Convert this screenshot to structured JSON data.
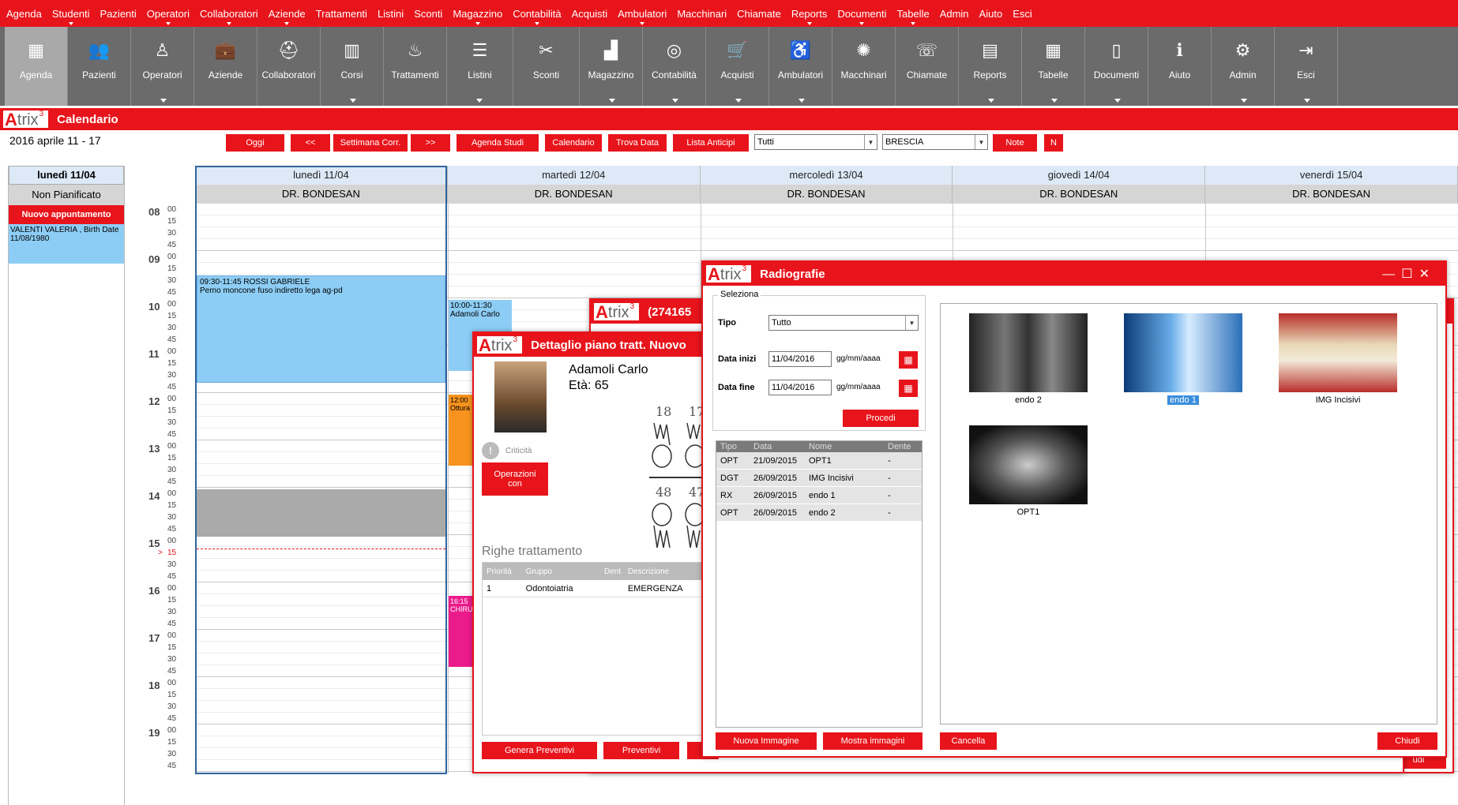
{
  "menu": [
    "Agenda",
    "Studenti",
    "Pazienti",
    "Operatori",
    "Collaboratori",
    "Aziende",
    "Trattamenti",
    "Listini",
    "Sconti",
    "Magazzino",
    "Contabilità",
    "Acquisti",
    "Ambulatori",
    "Macchinari",
    "Chiamate",
    "Reports",
    "Documenti",
    "Tabelle",
    "Admin",
    "Aiuto",
    "Esci"
  ],
  "toolbar": [
    {
      "label": "Agenda",
      "icon": "calendar-icon"
    },
    {
      "label": "Pazienti",
      "icon": "users-icon"
    },
    {
      "label": "Operatori",
      "icon": "operator-icon"
    },
    {
      "label": "Aziende",
      "icon": "briefcase-icon"
    },
    {
      "label": "Collaboratori",
      "icon": "collaborator-icon"
    },
    {
      "label": "Corsi",
      "icon": "books-icon"
    },
    {
      "label": "Trattamenti",
      "icon": "treatment-icon"
    },
    {
      "label": "Listini",
      "icon": "price-list-icon"
    },
    {
      "label": "Sconti",
      "icon": "discount-tag-icon"
    },
    {
      "label": "Magazzino",
      "icon": "warehouse-chart-icon"
    },
    {
      "label": "Contabilità",
      "icon": "coins-icon"
    },
    {
      "label": "Acquisti",
      "icon": "cart-icon"
    },
    {
      "label": "Ambulatori",
      "icon": "dental-chair-icon"
    },
    {
      "label": "Macchinari",
      "icon": "gear-machine-icon"
    },
    {
      "label": "Chiamate",
      "icon": "phone-icon"
    },
    {
      "label": "Reports",
      "icon": "report-icon"
    },
    {
      "label": "Tabelle",
      "icon": "table-icon"
    },
    {
      "label": "Documenti",
      "icon": "document-icon"
    },
    {
      "label": "Aiuto",
      "icon": "help-book-icon"
    },
    {
      "label": "Admin",
      "icon": "admin-settings-icon"
    },
    {
      "label": "Esci",
      "icon": "exit-icon"
    }
  ],
  "header": {
    "title": "Calendario",
    "logo_text": "trix",
    "logo_sup": "3"
  },
  "week_label": "2016 aprile 11 - 17",
  "controls": {
    "oggi": "Oggi",
    "prev": "<<",
    "settimana": "Settimana Corr.",
    "next": ">>",
    "agenda_studi": "Agenda Studi",
    "calendario": "Calendario",
    "trova_data": "Trova Data",
    "lista_anticipi": "Lista Anticipi",
    "filter_value": "Tutti",
    "location_value": "BRESCIA",
    "note": "Note",
    "n": "N"
  },
  "left_panel": {
    "day": "lunedì 11/04",
    "unplanned": "Non Pianificato",
    "new_appt": "Nuovo appuntamento",
    "appt_text": "VALENTI VALERIA , Birth Date 11/08/1980"
  },
  "days": [
    {
      "name": "lunedì 11/04",
      "doctor": "DR. BONDESAN"
    },
    {
      "name": "martedì 12/04",
      "doctor": "DR. BONDESAN"
    },
    {
      "name": "mercoledì 13/04",
      "doctor": "DR. BONDESAN"
    },
    {
      "name": "giovedì 14/04",
      "doctor": "DR. BONDESAN"
    },
    {
      "name": "venerdì 15/04",
      "doctor": "DR. BONDESAN"
    }
  ],
  "hours": [
    "08",
    "09",
    "10",
    "11",
    "12",
    "13",
    "14",
    "15",
    "16",
    "17",
    "18",
    "19"
  ],
  "minutes": [
    "00",
    "15",
    "30",
    "45"
  ],
  "current_marker": ">",
  "appointments": {
    "rossi_line1": "09:30-11:45 ROSSI GABRIELE",
    "rossi_line2": "Perno moncone fuso indiretto lega ag-pd",
    "adamoli": "10:00-11:30 Adamoli Carlo",
    "orange_time": "12:00",
    "orange_text": "Ottura",
    "pink_time": "16:15",
    "pink_text": "CHIRU"
  },
  "window_back": {
    "title": "(274165"
  },
  "window_detail": {
    "title": "Dettaglio piano tratt. Nuovo",
    "patient_name": "Adamoli Carlo",
    "patient_age": "Età: 65",
    "criticita": "Criticità",
    "operazioni": "Operazioni con",
    "teeth_top": [
      "18",
      "17"
    ],
    "teeth_bottom": [
      "48",
      "47"
    ],
    "righe_title": "Righe trattamento",
    "columns": [
      "Priorità",
      "Gruppo",
      "Dent",
      "Descrizione"
    ],
    "row": [
      "1",
      "Odontoiatria",
      "",
      "EMERGENZA"
    ],
    "btn_preventivi": "Genera Preventivi",
    "btn_preventivi2": "Preventivi"
  },
  "window_radio": {
    "title": "Radiografie",
    "seleziona": "Seleziona",
    "tipo_label": "Tipo",
    "tipo_value": "Tutto",
    "data_inizio_label": "Data inizi",
    "data_inizio_value": "11/04/2016",
    "data_fine_label": "Data fine",
    "data_fine_value": "11/04/2016",
    "date_format": "gg/mm/aaaa",
    "procedi": "Procedi",
    "columns": [
      "Tipo",
      "Data",
      "Nome",
      "Dente"
    ],
    "rows": [
      [
        "OPT",
        "21/09/2015",
        "OPT1",
        "-"
      ],
      [
        "DGT",
        "26/09/2015",
        "IMG Incisivi",
        "-"
      ],
      [
        "RX",
        "26/09/2015",
        "endo 1",
        "-"
      ],
      [
        "OPT",
        "26/09/2015",
        "endo 2",
        "-"
      ]
    ],
    "images": [
      "endo 2",
      "endo 1",
      "IMG Incisivi",
      "OPT1"
    ],
    "nuova": "Nuova Immagine",
    "mostra": "Mostra immagini",
    "cancella": "Cancella",
    "chiudi": "Chiudi",
    "chiudi_behind": "udi"
  },
  "colors": {
    "accent": "#e8141b",
    "toolbar": "#6b6b6b",
    "appt_blue": "#8dcdf5",
    "orange": "#f7931e",
    "pink": "#ec1b8c"
  }
}
